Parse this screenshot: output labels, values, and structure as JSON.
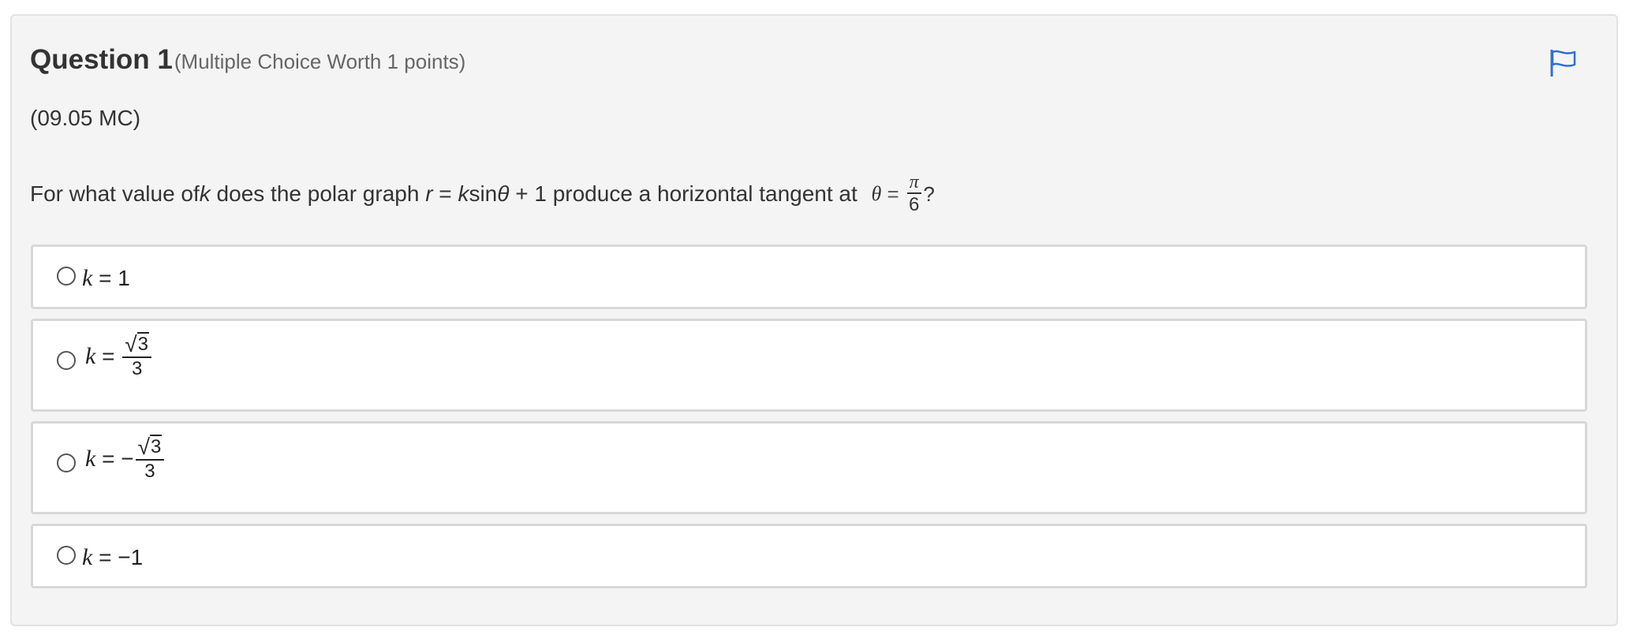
{
  "question": {
    "title": "Question 1",
    "worth": "(Multiple Choice Worth 1 points)",
    "code": "(09.05 MC)",
    "text": {
      "prefix": "For what value of ",
      "k": "k",
      "mid1": " does the polar graph ",
      "r": "r",
      "eq": " = ",
      "k2": "k",
      "sin": "sin",
      "theta": "θ",
      "mid2": " + 1 produce a horizontal tangent at ",
      "theta2": "θ",
      "eq2": " = ",
      "pi": "π",
      "six": "6",
      "end": "?"
    }
  },
  "options": [
    {
      "k": "k",
      "rest": " = 1"
    },
    {
      "k": "k",
      "eq": " = ",
      "num": "3",
      "den": "3"
    },
    {
      "k": "k",
      "eq": " = −",
      "num": "3",
      "den": "3"
    },
    {
      "k": "k",
      "rest": " = −1"
    }
  ],
  "icons": {
    "flag": "flag-icon",
    "radio": "radio-button"
  },
  "colors": {
    "card_bg": "#f4f4f4",
    "flag": "#2f6fd1",
    "border": "#d8d8d8"
  }
}
